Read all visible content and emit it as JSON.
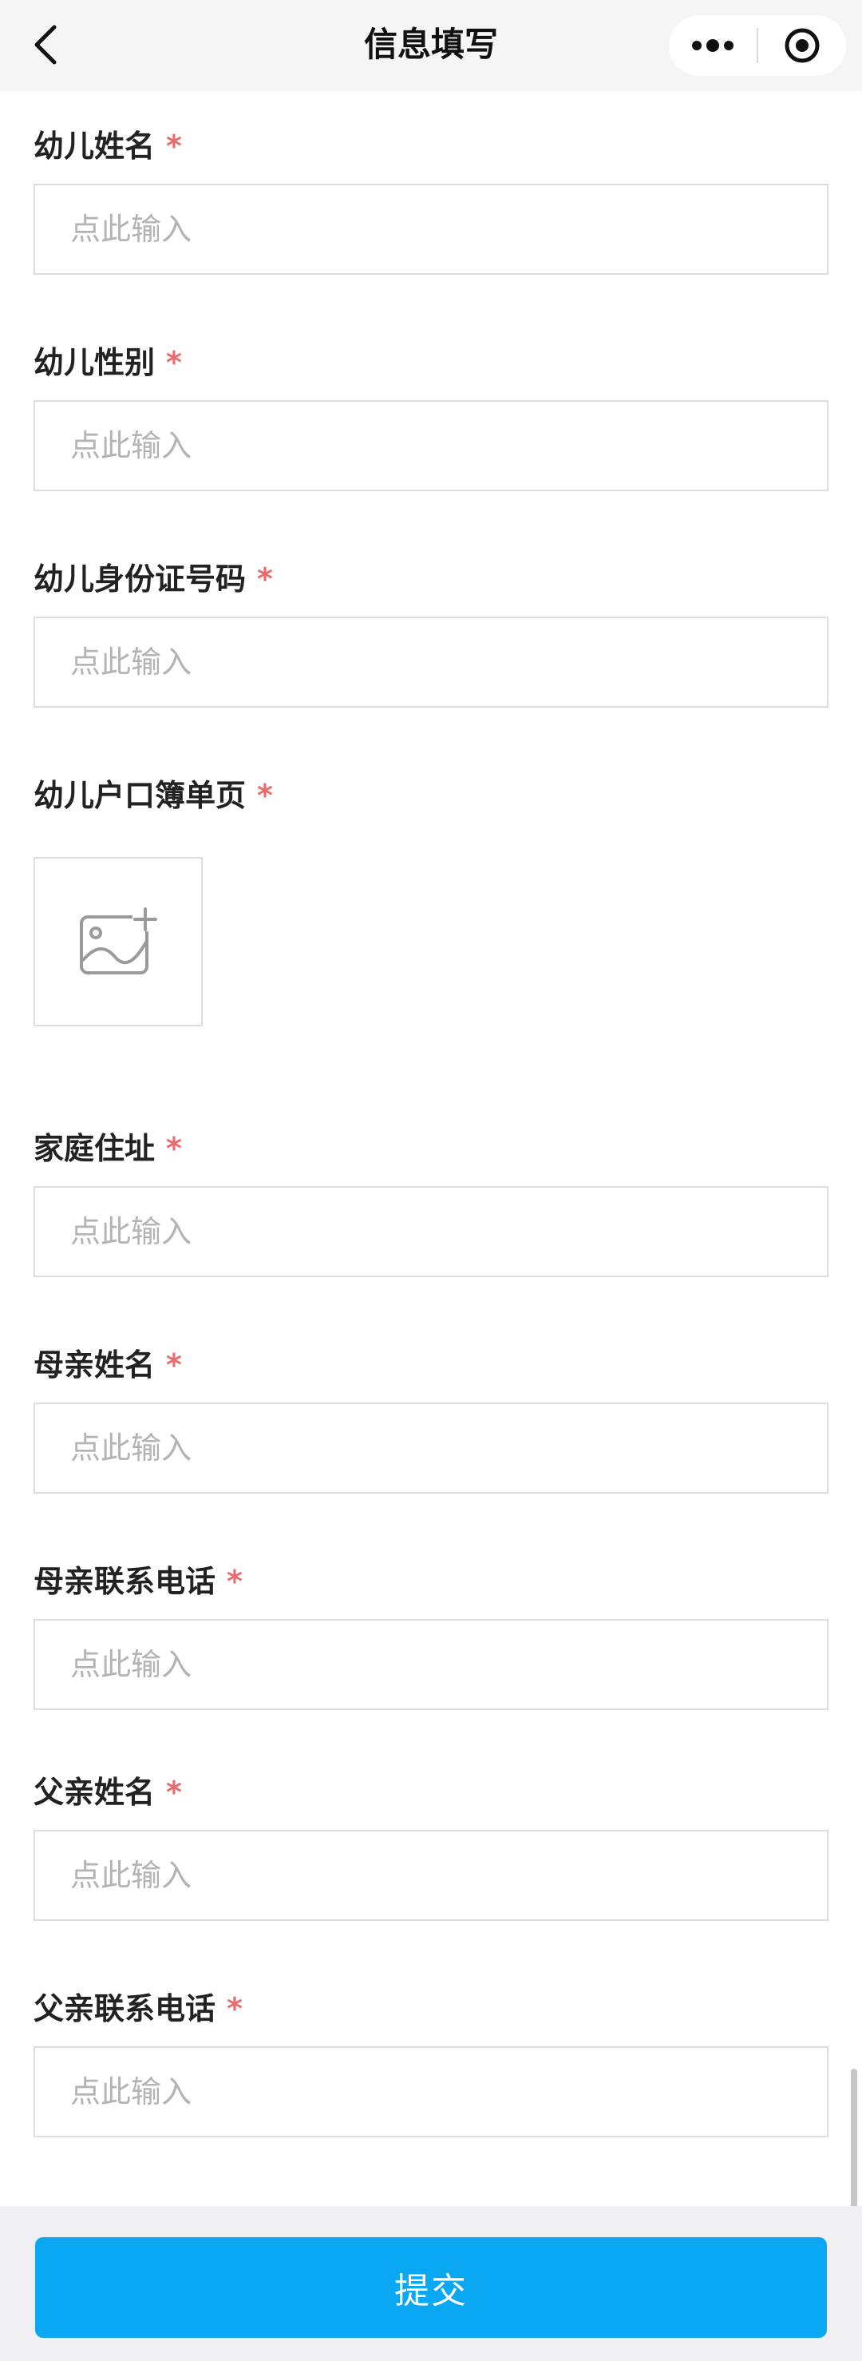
{
  "nav": {
    "title": "信息填写",
    "icons": {
      "back": "back-arrow-icon",
      "more": "more-dots-icon",
      "close": "target-close-icon"
    }
  },
  "form": {
    "required_mark": "*",
    "fields": [
      {
        "label": "幼儿姓名",
        "placeholder": "点此输入",
        "value": ""
      },
      {
        "label": "幼儿性别",
        "placeholder": "点此输入",
        "value": ""
      },
      {
        "label": "幼儿身份证号码",
        "placeholder": "点此输入",
        "value": ""
      },
      {
        "label": "幼儿户口簿单页",
        "upload_icon": "add-image-icon"
      },
      {
        "label": "家庭住址",
        "placeholder": "点此输入",
        "value": ""
      },
      {
        "label": "母亲姓名",
        "placeholder": "点此输入",
        "value": ""
      },
      {
        "label": "母亲联系电话",
        "placeholder": "点此输入",
        "value": ""
      },
      {
        "label": "父亲姓名",
        "placeholder": "点此输入",
        "value": ""
      },
      {
        "label": "父亲联系电话",
        "placeholder": "点此输入",
        "value": ""
      }
    ]
  },
  "footer": {
    "submit_label": "提交"
  },
  "colors": {
    "accent": "#0aa8f2",
    "required": "#ea6b6b",
    "navbar_bg": "#f5f5f5",
    "footer_bg": "#efeff4",
    "placeholder": "#b3b3b3",
    "border": "#dcdcdc"
  }
}
